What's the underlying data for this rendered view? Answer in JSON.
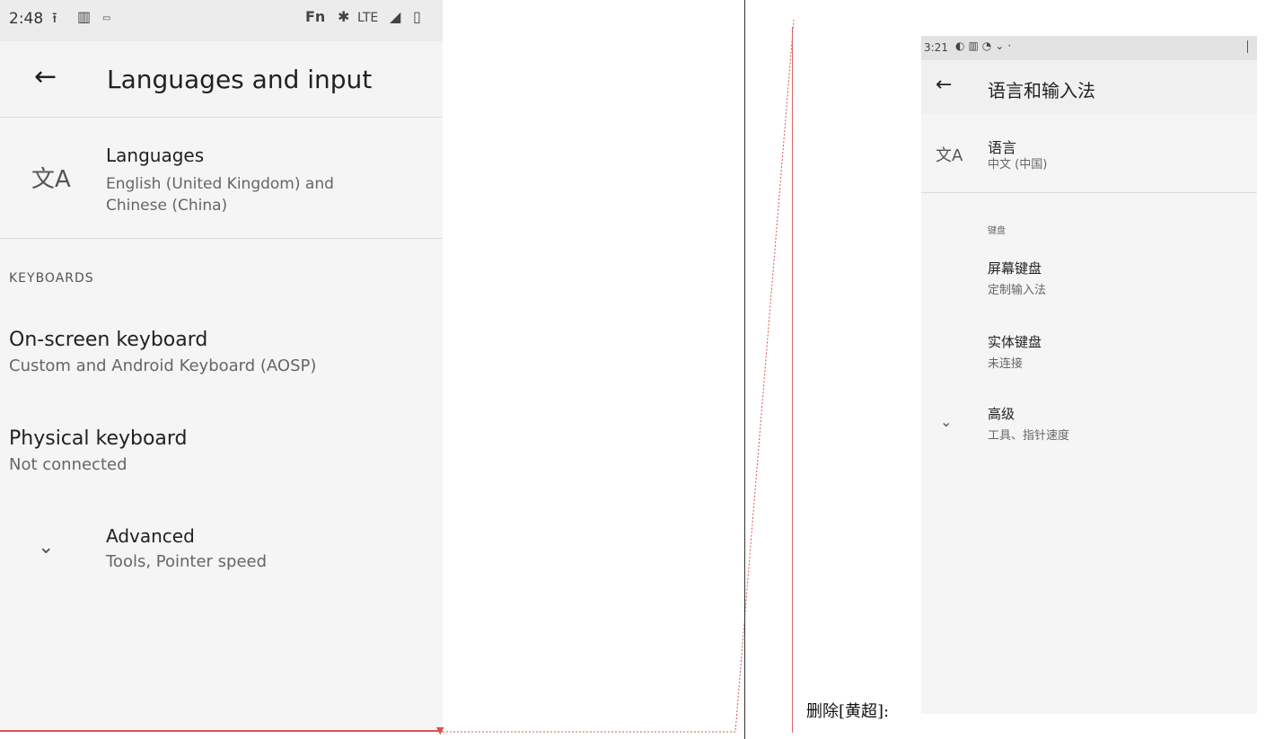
{
  "left_screen": {
    "status": {
      "time": "2:48",
      "carrier_text": "Fn",
      "network": "LTE"
    },
    "appbar": {
      "title": "Languages and input"
    },
    "languages": {
      "title": "Languages",
      "summary": "English (United Kingdom) and Chinese (China)"
    },
    "keyboards_header": "KEYBOARDS",
    "on_screen": {
      "title": "On-screen keyboard",
      "summary": "Custom and Android Keyboard (AOSP)"
    },
    "physical": {
      "title": "Physical keyboard",
      "summary": "Not connected"
    },
    "advanced": {
      "title": "Advanced",
      "summary": "Tools, Pointer speed"
    }
  },
  "annotation": {
    "comment_label": "删除[黄超]:",
    "color": "#d9534f"
  },
  "right_screen": {
    "status": {
      "time": "3:21"
    },
    "appbar": {
      "title": "语言和输入法"
    },
    "languages": {
      "title": "语言",
      "summary": "中文 (中国)"
    },
    "keyboards_header": "键盘",
    "on_screen": {
      "title": "屏幕键盘",
      "summary": "定制输入法"
    },
    "physical": {
      "title": "实体键盘",
      "summary": "未连接"
    },
    "advanced": {
      "title": "高级",
      "summary": "工具、指针速度"
    }
  }
}
